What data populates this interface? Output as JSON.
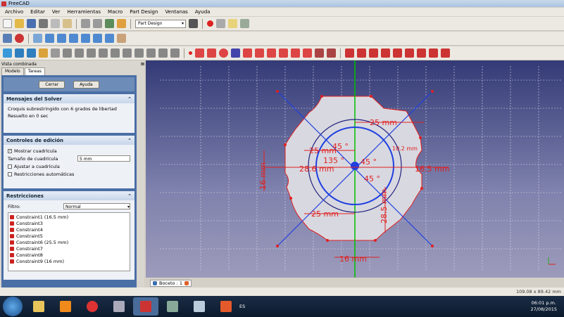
{
  "window": {
    "title": "FreeCAD"
  },
  "menu": [
    "Archivo",
    "Editar",
    "Ver",
    "Herramientas",
    "Macro",
    "Part Design",
    "Ventanas",
    "Ayuda"
  ],
  "workbench": "Part Design",
  "panel": {
    "title": "Vista combinada",
    "tabs": [
      "Modelo",
      "Tareas"
    ],
    "buttons": {
      "close": "Cerrar",
      "help": "Ayuda"
    },
    "solver": {
      "title": "Mensajes del Solver",
      "line1": "Croquis subrestringido con 6 grados de libertad",
      "line2": "Resuelto en 0 sec"
    },
    "edit": {
      "title": "Controles de edición",
      "show_grid": "Mostrar cuadrícula",
      "grid_size_label": "Tamaño de cuadrícula",
      "grid_size_value": "5 mm",
      "snap": "Ajustar a cuadrícula",
      "auto_constraints": "Restricciones automáticas"
    },
    "constraints": {
      "title": "Restricciones",
      "filter_label": "Filtro:",
      "filter_value": "Normal",
      "items": [
        "Constraint1 (16.5 mm)",
        "Constraint3",
        "Constraint4",
        "Constraint5",
        "Constraint6 (25.5 mm)",
        "Constraint7",
        "Constraint8",
        "Constraint9 (16 mm)"
      ]
    }
  },
  "sketch": {
    "dimensions": [
      "25 mm",
      "25 mm",
      "25 mm",
      "28.6 mm",
      "16.5 mm",
      "16 mm",
      "16 mm",
      "16 mm",
      "28.5 mm",
      "45 °",
      "45 °",
      "45 °",
      "135 °",
      "10.2 mm"
    ]
  },
  "view_tab": "Boceto : 1",
  "status": "109.08 x 89.42 mm",
  "clock": {
    "time": "06:01 p.m.",
    "date": "27/08/2015"
  },
  "lang": "ES",
  "colors": {
    "constraint": "#e02020",
    "axis_green": "#00c000",
    "geometry": "#202080",
    "construction": "#2040e0"
  }
}
